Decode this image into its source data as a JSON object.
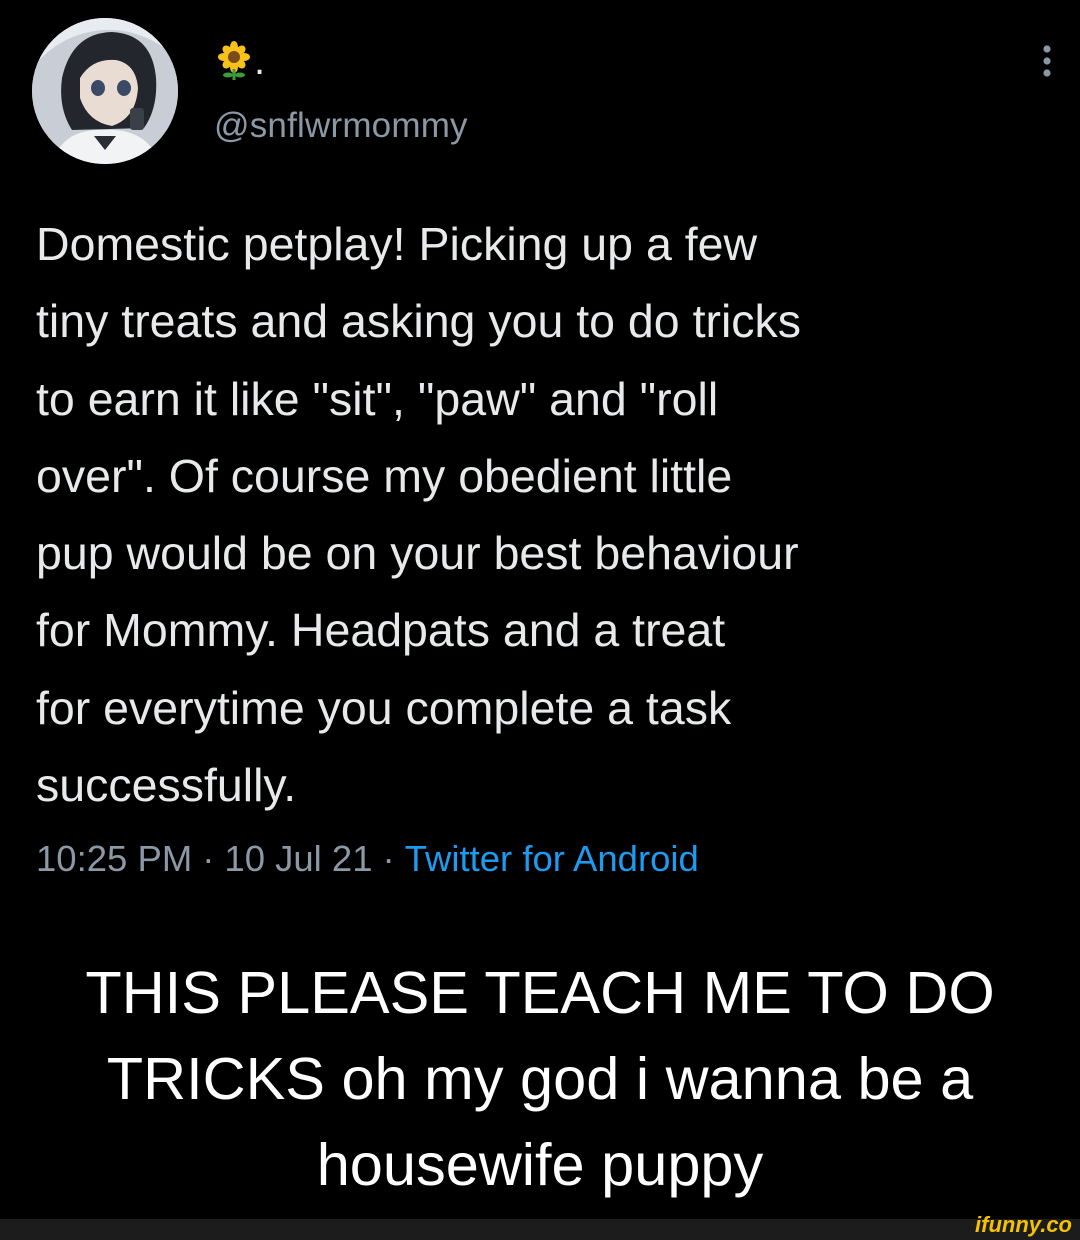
{
  "tweet": {
    "display_name": ".",
    "display_name_icon": "sunflower-icon",
    "handle": "@snflwrmommy",
    "text": "Domestic petplay! Picking up a few\ntiny treats and asking you to do tricks\nto earn it like \"sit\", \"paw\" and \"roll\nover\". Of course my obedient little\npup would be on your best behaviour\nfor Mommy. Headpats and a treat\nfor everytime you complete a task\nsuccessfully.",
    "time": "10:25 PM",
    "date": "10 Jul 21",
    "separator": "·",
    "source": "Twitter for Android",
    "more_icon": "more-vertical-icon"
  },
  "caption": "THIS PLEASE TEACH ME TO DO\nTRICKS oh my god i wanna be a\nhousewife puppy",
  "watermark": "ifunny.co",
  "colors": {
    "background": "#000000",
    "text": "#e7e9ea",
    "secondary_text": "#8b98a5",
    "link": "#1d9bf0",
    "caption": "#ffffff",
    "watermark": "#f4c200"
  }
}
